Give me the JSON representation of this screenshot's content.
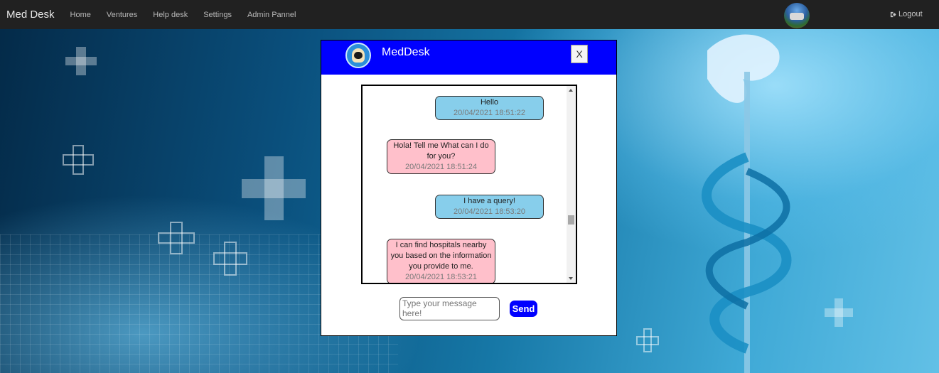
{
  "navbar": {
    "brand": "Med Desk",
    "links": [
      "Home",
      "Ventures",
      "Help desk",
      "Settings",
      "Admin Pannel"
    ],
    "logout_label": "Logout"
  },
  "chat": {
    "title": "MedDesk",
    "close_label": "X",
    "messages": [
      {
        "sender": "user",
        "text": "Hello",
        "time": "20/04/2021 18:51:22"
      },
      {
        "sender": "bot",
        "text": "Hola! Tell me What can I do for you?",
        "time": "20/04/2021 18:51:24"
      },
      {
        "sender": "user",
        "text": "I have a query!",
        "time": "20/04/2021 18:53:20"
      },
      {
        "sender": "bot",
        "text": "I can find hospitals nearby you based on the information you provide to me.",
        "time": "20/04/2021 18:53:21"
      }
    ],
    "input_placeholder": "Type your message here!",
    "send_label": "Send"
  },
  "colors": {
    "navbar_bg": "#212121",
    "header_bg": "#0000ff",
    "user_bubble": "#87ceeb",
    "bot_bubble": "#ffc0cb",
    "send_button": "#0000ff"
  }
}
